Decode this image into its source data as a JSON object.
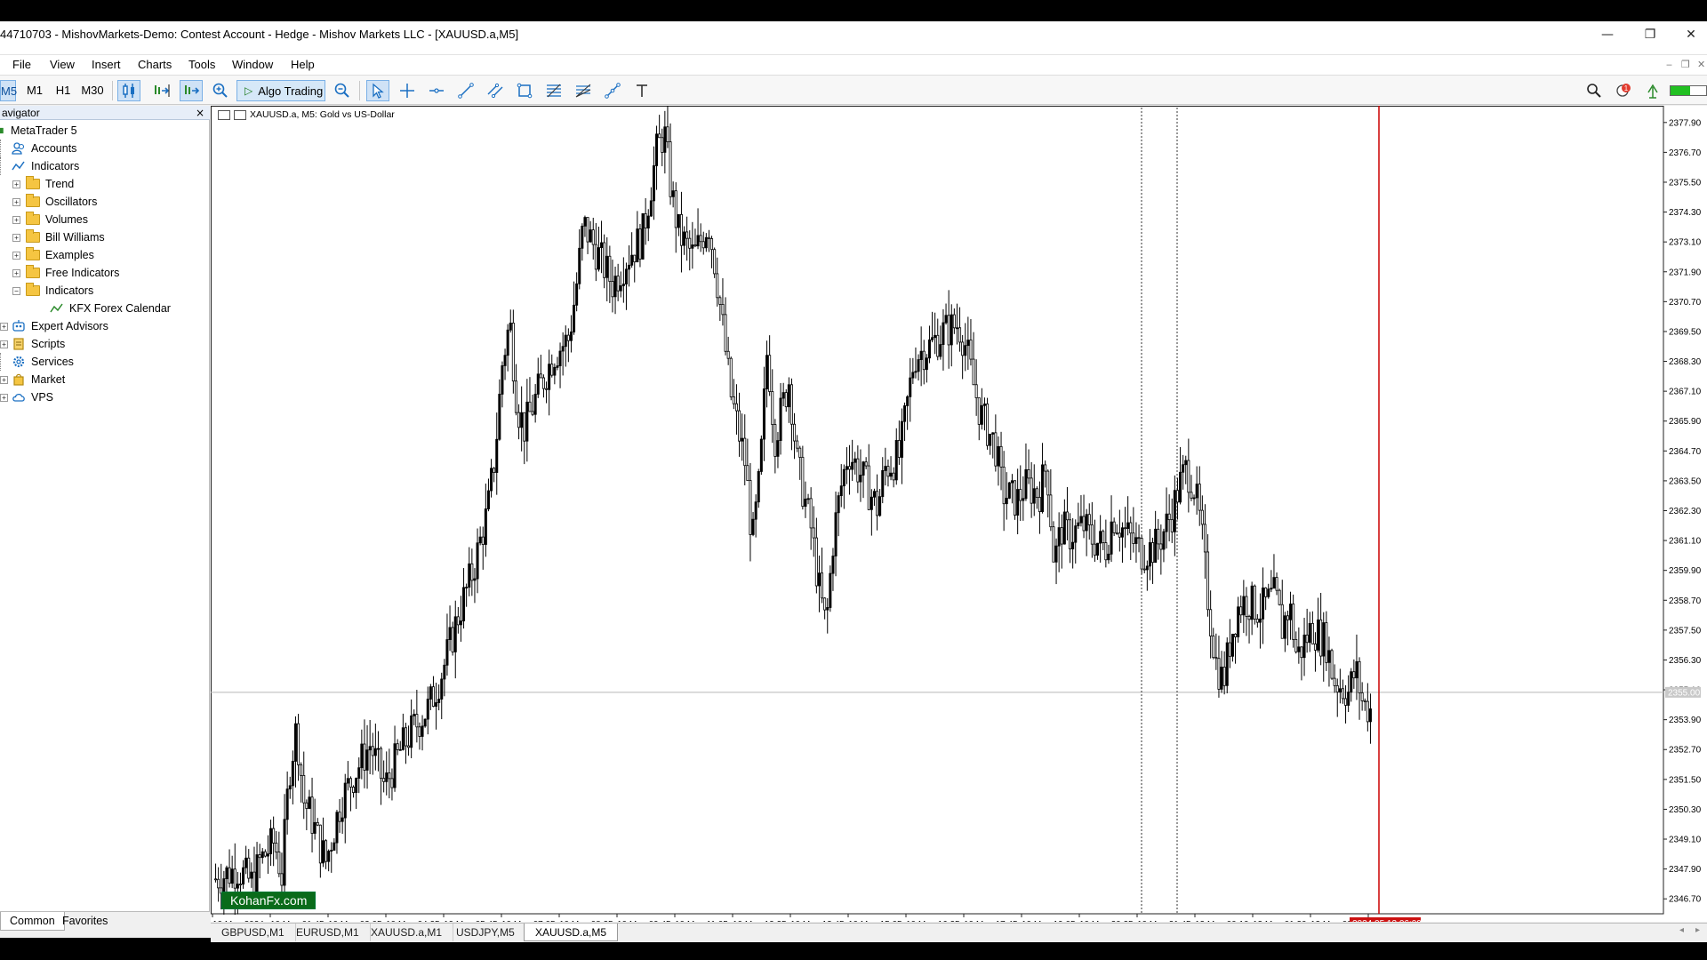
{
  "window": {
    "title": "44710703 - MishovMarkets-Demo: Contest Account - Hedge - Mishov Markets LLC - [XAUUSD.a,M5]",
    "minimize_glyph": "—",
    "restore_glyph": "❐",
    "close_glyph": "✕",
    "mdi_glyphs": [
      "‒",
      "❐",
      "✕"
    ]
  },
  "menu": [
    "File",
    "View",
    "Insert",
    "Charts",
    "Tools",
    "Window",
    "Help"
  ],
  "toolbar": {
    "timeframes": [
      "M5",
      "M1",
      "H1",
      "M30"
    ],
    "active_timeframe": "M5",
    "algo_trading_label": "Algo Trading",
    "notification_count": "1"
  },
  "navigator": {
    "title": "Navigator",
    "title_shown": "avigator",
    "close_glyph": "×",
    "root": "MetaTrader 5",
    "items": [
      {
        "label": "Accounts",
        "icon": "accounts-icon"
      },
      {
        "label": "Indicators",
        "icon": "indicator-icon"
      },
      {
        "label": "Trend",
        "icon": "folder-icon"
      },
      {
        "label": "Oscillators",
        "icon": "folder-icon"
      },
      {
        "label": "Volumes",
        "icon": "folder-icon"
      },
      {
        "label": "Bill Williams",
        "icon": "folder-icon"
      },
      {
        "label": "Examples",
        "icon": "folder-icon"
      },
      {
        "label": "Free Indicators",
        "icon": "folder-icon"
      },
      {
        "label": "Indicators",
        "icon": "folder-icon"
      },
      {
        "label": "KFX Forex Calendar",
        "icon": "indicator-icon"
      },
      {
        "label": "Expert Advisors",
        "icon": "expert-icon"
      },
      {
        "label": "Scripts",
        "icon": "script-icon"
      },
      {
        "label": "Services",
        "icon": "gear-icon"
      },
      {
        "label": "Market",
        "icon": "bag-icon"
      },
      {
        "label": "VPS",
        "icon": "cloud-icon"
      }
    ],
    "tabs": [
      "Common",
      "Favorites"
    ],
    "active_tab": "Common"
  },
  "chart": {
    "header": "XAUUSD.a, M5:  Gold vs US-Dollar",
    "watermark": "KohanFx.com",
    "price_labels": [
      "2377.90",
      "2376.70",
      "2375.50",
      "2374.30",
      "2373.10",
      "2371.90",
      "2370.70",
      "2369.50",
      "2368.30",
      "2367.10",
      "2365.90",
      "2364.70",
      "2363.50",
      "2362.30",
      "2361.10",
      "2359.90",
      "2358.70",
      "2357.50",
      "2356.30",
      "2355.10",
      "2353.90",
      "2352.70",
      "2351.50",
      "2350.30",
      "2349.10",
      "2347.90",
      "2346.70"
    ],
    "current_price_label": "2355.00",
    "time_labels": [
      "10 May 2024",
      "10 May 01:45",
      "10 May 03:05",
      "10 May 04:25",
      "10 May 05:45",
      "10 May 07:05",
      "10 May 08:25",
      "10 May 09:45",
      "10 May 11:05",
      "10 May 12:25",
      "10 May 13:45",
      "10 May 15:05",
      "10 May 16:25",
      "10 May 17:45",
      "10 May 19:05",
      "10 May 20:25",
      "10 May 21:45",
      "13 May 00:10",
      "13 May 01:30",
      "13 May 02:50",
      "13 May 04:"
    ],
    "cursor_time_label": "2024.05.13 06:00",
    "colors": {
      "candle": "#000000",
      "cursor_line": "#cc0000",
      "cursor_label_bg": "#cc1111",
      "watermark_bg": "#0a6b1a"
    }
  },
  "chart_data": {
    "type": "candlestick",
    "symbol": "XAUUSD.a",
    "timeframe": "M5",
    "ylim": [
      2346.1,
      2378.5
    ],
    "current_price": 2355.0,
    "close_path": [
      [
        0,
        2347.5
      ],
      [
        3,
        2347.9
      ],
      [
        5,
        2347.3
      ],
      [
        6,
        2348.2
      ],
      [
        8,
        2349.0
      ],
      [
        9,
        2347.6
      ],
      [
        10,
        2351.8
      ],
      [
        11,
        2353.6
      ],
      [
        12,
        2350.6
      ],
      [
        13,
        2350.0
      ],
      [
        14,
        2349.0
      ],
      [
        15,
        2348.2
      ],
      [
        17,
        2350.6
      ],
      [
        19,
        2351.8
      ],
      [
        21,
        2352.9
      ],
      [
        23,
        2351.2
      ],
      [
        25,
        2352.6
      ],
      [
        27,
        2353.6
      ],
      [
        29,
        2354.4
      ],
      [
        31,
        2356.0
      ],
      [
        33,
        2358.1
      ],
      [
        35,
        2359.9
      ],
      [
        37,
        2362.3
      ],
      [
        38,
        2364.6
      ],
      [
        39,
        2368.3
      ],
      [
        40,
        2369.9
      ],
      [
        41,
        2366.5
      ],
      [
        42,
        2365.6
      ],
      [
        44,
        2367.2
      ],
      [
        46,
        2368.6
      ],
      [
        48,
        2369.2
      ],
      [
        49,
        2371.2
      ],
      [
        50,
        2373.8
      ],
      [
        52,
        2372.6
      ],
      [
        54,
        2371.4
      ],
      [
        56,
        2372.5
      ],
      [
        58,
        2373.3
      ],
      [
        60,
        2376.8
      ],
      [
        61,
        2377.5
      ],
      [
        62,
        2375.0
      ],
      [
        63,
        2373.4
      ],
      [
        65,
        2372.5
      ],
      [
        67,
        2373.9
      ],
      [
        68,
        2372.0
      ],
      [
        70,
        2367.0
      ],
      [
        72,
        2364.2
      ],
      [
        73,
        2361.0
      ],
      [
        74,
        2363.7
      ],
      [
        75,
        2368.9
      ],
      [
        76,
        2365.2
      ],
      [
        78,
        2367.6
      ],
      [
        79,
        2364.3
      ],
      [
        81,
        2361.5
      ],
      [
        82,
        2359.2
      ],
      [
        83,
        2357.6
      ],
      [
        84,
        2361.3
      ],
      [
        85,
        2363.2
      ],
      [
        86,
        2364.7
      ],
      [
        88,
        2363.6
      ],
      [
        90,
        2362.4
      ],
      [
        91,
        2364.0
      ],
      [
        93,
        2364.5
      ],
      [
        95,
        2368.5
      ],
      [
        97,
        2368.9
      ],
      [
        99,
        2369.5
      ],
      [
        101,
        2369.8
      ],
      [
        102,
        2368.9
      ],
      [
        103,
        2367.4
      ],
      [
        104,
        2366.2
      ],
      [
        106,
        2364.9
      ],
      [
        107,
        2363.0
      ],
      [
        109,
        2362.7
      ],
      [
        110,
        2363.3
      ],
      [
        112,
        2363.0
      ],
      [
        113,
        2364.2
      ],
      [
        114,
        2360.2
      ],
      [
        115,
        2361.6
      ],
      [
        116,
        2361.3
      ],
      [
        118,
        2361.7
      ],
      [
        119,
        2361.2
      ],
      [
        121,
        2360.8
      ],
      [
        122,
        2362.1
      ],
      [
        124,
        2361.3
      ],
      [
        126,
        2360.6
      ],
      [
        128,
        2360.9
      ],
      [
        130,
        2362.2
      ],
      [
        131,
        2363.3
      ],
      [
        132,
        2364.0
      ],
      [
        133,
        2363.3
      ],
      [
        134,
        2361.5
      ],
      [
        135,
        2358.5
      ],
      [
        136,
        2356.2
      ],
      [
        137,
        2355.4
      ],
      [
        138,
        2357.2
      ],
      [
        139,
        2358.4
      ],
      [
        140,
        2358.7
      ],
      [
        142,
        2358.3
      ],
      [
        144,
        2358.9
      ],
      [
        145,
        2357.6
      ],
      [
        146,
        2358.5
      ],
      [
        147,
        2356.4
      ],
      [
        149,
        2357.6
      ],
      [
        151,
        2357.0
      ],
      [
        152,
        2355.5
      ],
      [
        154,
        2355.0
      ],
      [
        155,
        2355.9
      ],
      [
        156,
        2354.5
      ],
      [
        157,
        2354.3
      ]
    ]
  }
}
